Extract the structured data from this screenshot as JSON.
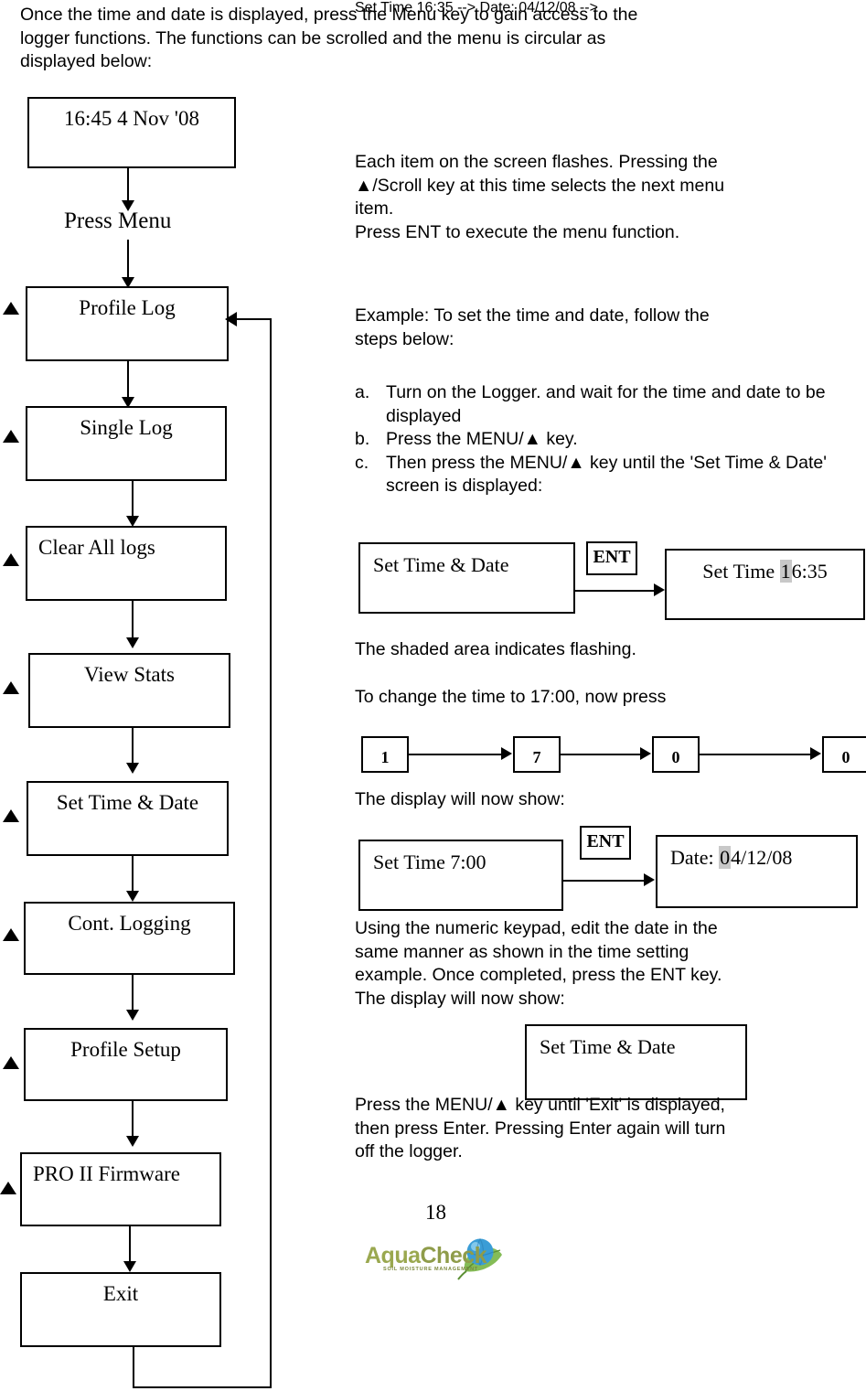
{
  "document": {
    "page_number": "18",
    "intro_paragraph": "Once the time and date is displayed, press the Menu key to gain access to the\nlogger functions.  The functions can be scrolled and the menu is circular as\ndisplayed below:"
  },
  "flowchart": {
    "start_screen": "16:45  4 Nov '08",
    "press_menu_label": "Press Menu",
    "menu_items": [
      {
        "label": "Profile Log",
        "align": "center"
      },
      {
        "label": "Single Log",
        "align": "center"
      },
      {
        "label": "Clear All logs",
        "align": "left"
      },
      {
        "label": "View Stats",
        "align": "center"
      },
      {
        "label": "Set Time & Date",
        "align": "center"
      },
      {
        "label": "Cont. Logging",
        "align": "center"
      },
      {
        "label": "Profile Setup",
        "align": "center"
      },
      {
        "label": "PRO II Firmware",
        "align": "left"
      },
      {
        "label": "Exit",
        "align": "center"
      }
    ],
    "scroll_key_icon": "up-triangle"
  },
  "right_column": {
    "para_flashing": "Each item on the screen flashes.  Pressing the\n▲/Scroll key at this time selects the next menu\nitem.\nPress ENT to execute the menu function.",
    "para_example": "Example:  To set the time and date, follow the\nsteps below:",
    "steps": [
      {
        "marker": "a.",
        "text": "Turn on the Logger.  and wait for the time and date to be displayed"
      },
      {
        "marker": "b.",
        "text": "Press the MENU/▲ key."
      },
      {
        "marker": "c.",
        "text": "Then press the MENU/▲ key until the 'Set Time & Date' screen is displayed:"
      }
    ],
    "diagram_1": {
      "left_screen": "Set Time & Date",
      "ent_label": "ENT",
      "right_screen_prefix": "Set Time  ",
      "right_screen_flash": "1",
      "right_screen_rest": "6:35"
    },
    "para_shaded": "The shaded area indicates flashing.",
    "para_change_time": "To change the time to 17:00, now press",
    "keypad_sequence": [
      "1",
      "7",
      "0",
      "0"
    ],
    "para_display_show": "The display will now show:",
    "diagram_2": {
      "left_screen": "Set Time   7:00",
      "ent_label": "ENT",
      "right_screen_prefix": "Date:   ",
      "right_screen_flash": "0",
      "right_screen_rest": "4/12/08"
    },
    "para_keypad": "Using the numeric keypad, edit the date in the\nsame manner as shown in the time setting\nexample.  Once completed, press the ENT key.\nThe display will now show:",
    "final_screen": "Set Time & Date",
    "para_final": "Press the MENU/▲ key until 'Exit' is displayed,\nthen press Enter.  Pressing Enter again will turn\noff the logger."
  },
  "logo": {
    "name_part1": "Aqua",
    "name_part2": "Check",
    "tagline": "SOIL MOISTURE MANAGEMENT"
  },
  "colors": {
    "text": "#000000",
    "flash_shade": "#c8c8c8",
    "logo_green": "#9aa84f",
    "logo_globe_blue": "#3a9dd6",
    "logo_leaf_green": "#7ab648"
  }
}
